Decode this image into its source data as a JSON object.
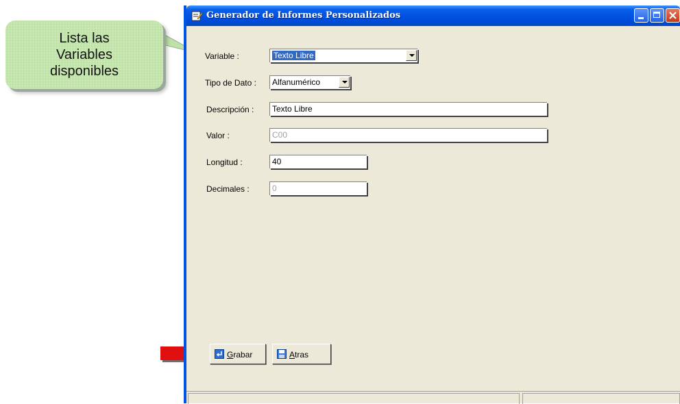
{
  "callout": {
    "lines": [
      "Lista las",
      "Variables",
      "disponibles"
    ]
  },
  "window": {
    "title": "Generador de Informes Personalizados",
    "icon": "report-edit-icon",
    "title_color": "#0054e3"
  },
  "form": {
    "variable": {
      "label": "Variable :",
      "value": "Texto Libre"
    },
    "tipo_dato": {
      "label": "Tipo de Dato :",
      "value": "Alfanumérico"
    },
    "descripcion": {
      "label": "Descripción :",
      "value": "Texto Libre"
    },
    "valor": {
      "label": "Valor :",
      "value": "C00"
    },
    "longitud": {
      "label": "Longitud :",
      "value": "40"
    },
    "decimales": {
      "label": "Decimales :",
      "value": "0"
    }
  },
  "buttons": {
    "grabar": {
      "label": "Grabar",
      "icon": "enter-icon"
    },
    "atras": {
      "label": "Atras",
      "icon": "floppy-disk-icon"
    }
  },
  "colors": {
    "window_bg": "#ece9d8",
    "callout_bg": "#bfe3a6",
    "arrow": "#e01010"
  }
}
